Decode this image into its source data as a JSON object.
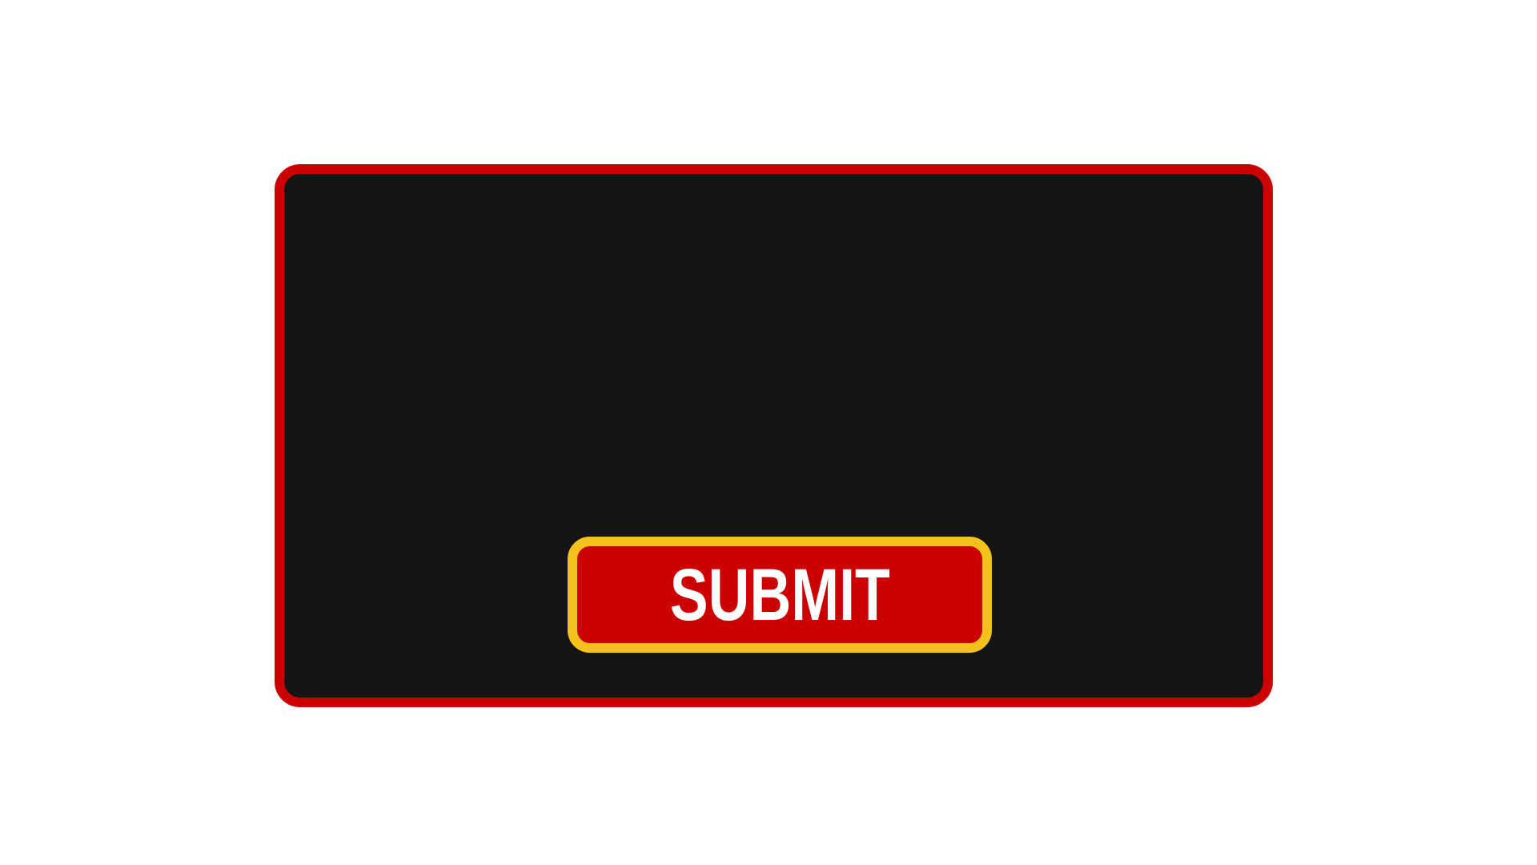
{
  "colors": {
    "background": "#ffffff",
    "panel_fill": "#141414",
    "panel_border": "#cc0000",
    "button_fill": "#cc0000",
    "button_border": "#f5c21b",
    "button_text": "#ffffff"
  },
  "panel": {
    "submit_button": {
      "label": "SUBMIT"
    }
  }
}
